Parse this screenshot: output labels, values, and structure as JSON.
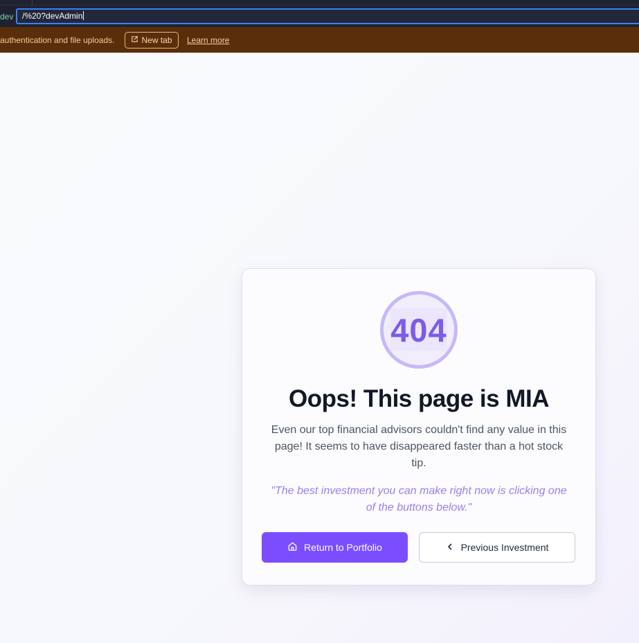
{
  "browser": {
    "url_prefix": "dev",
    "url_value": "/%20?devAdmin"
  },
  "banner": {
    "message": "authentication and file uploads.",
    "new_tab_label": "New tab",
    "learn_more_label": "Learn more"
  },
  "error_card": {
    "code": "404",
    "title": "Oops! This page is MIA",
    "description": "Even our top financial advisors couldn't find any value in this page! It seems to have disappeared faster than a hot stock tip.",
    "quote": "\"The best investment you can make right now is clicking one of the buttons below.\"",
    "primary_button": "Return to Portfolio",
    "secondary_button": "Previous Investment"
  },
  "colors": {
    "accent": "#7c4dff",
    "banner_bg": "#5a2e0a",
    "ring": "#c7b8f8",
    "quote_text": "#9a7ef0"
  },
  "icons": {
    "new_tab": "external-link-icon",
    "primary": "home-icon",
    "secondary": "chevron-left-icon"
  }
}
